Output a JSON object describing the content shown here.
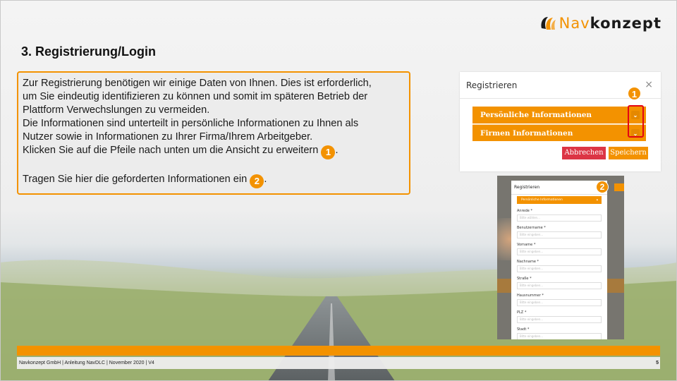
{
  "brand": {
    "name_part1": "Nav",
    "name_part2": "konzept",
    "accent_color": "#f39200"
  },
  "slide": {
    "title": "3. Registrierung/Login",
    "page_number": "5",
    "footer": "Navkonzept GmbH  |  Anleitung NavDLC  |  November 2020  |  V4"
  },
  "text_box": {
    "line1": "Zur Registrierung benötigen wir einige Daten von Ihnen. Dies ist erforderlich,",
    "line2": "um Sie eindeutig identifizieren zu können und somit im späteren Betrieb der",
    "line3": "Plattform Verwechslungen zu vermeiden.",
    "line4": "Die Informationen sind unterteilt in persönliche Informationen zu Ihnen als",
    "line5": "Nutzer sowie in Informationen zu Ihrer Firma/Ihrem Arbeitgeber.",
    "line6": "Klicken Sie auf die Pfeile nach unten um die Ansicht zu erweitern",
    "line6_marker": "1",
    "line6_end": ".",
    "line7": "Tragen Sie hier die geforderten Informationen ein",
    "line7_marker": "2",
    "line7_end": "."
  },
  "register_dialog": {
    "title": "Registrieren",
    "close_glyph": "×",
    "marker": "1",
    "sections": [
      {
        "label": "Persönliche Informationen",
        "chevron": "⌄"
      },
      {
        "label": "Firmen Informationen",
        "chevron": "⌄"
      }
    ],
    "cancel_label": "Abbrechen",
    "save_label": "Speichern"
  },
  "register_form": {
    "title": "Registrieren",
    "marker": "2",
    "section_label": "Persönliche Informationen",
    "section_chevron": "▴",
    "fields": [
      {
        "label": "Anrede *",
        "placeholder": "Bitte wählen..."
      },
      {
        "label": "Benutzername *",
        "placeholder": "Bitte eingeben..."
      },
      {
        "label": "Vorname *",
        "placeholder": "Bitte eingeben..."
      },
      {
        "label": "Nachname *",
        "placeholder": "Bitte eingeben..."
      },
      {
        "label": "Straße *",
        "placeholder": "Bitte eingeben..."
      },
      {
        "label": "Hausnummer *",
        "placeholder": "Bitte eingeben..."
      },
      {
        "label": "PLZ *",
        "placeholder": "Bitte eingeben..."
      },
      {
        "label": "Stadt *",
        "placeholder": "Bitte eingeben..."
      }
    ]
  }
}
